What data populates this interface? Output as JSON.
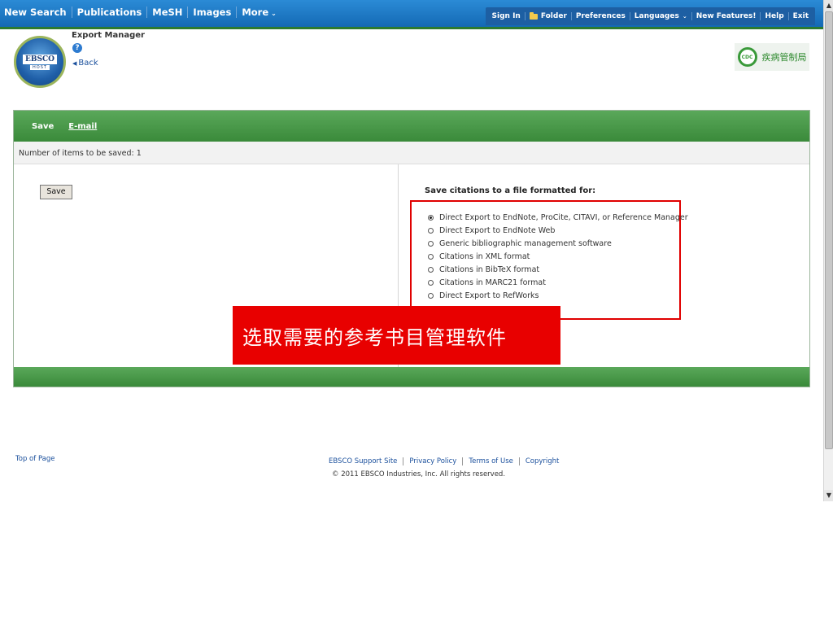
{
  "topnav": {
    "items": [
      "New Search",
      "Publications",
      "MeSH",
      "Images"
    ],
    "more_label": "More",
    "links": [
      "Sign In",
      "Folder",
      "Preferences",
      "Languages",
      "New Features!",
      "Help",
      "Exit"
    ]
  },
  "header": {
    "logo_text": "EBSCO",
    "logo_sub": "HOST",
    "title": "Export Manager",
    "help_icon": "?",
    "back_label": "Back",
    "institution_name": "疾病管制局",
    "institution_emblem": "CDC"
  },
  "panel": {
    "tabs": [
      "Save",
      "E-mail"
    ],
    "items_count_text": "Number of items to be saved: 1",
    "save_button": "Save",
    "format_title": "Save citations to a file formatted for:",
    "formats": [
      {
        "label": "Direct Export to EndNote, ProCite, CITAVI, or Reference Manager",
        "checked": true
      },
      {
        "label": "Direct Export to EndNote Web",
        "checked": false
      },
      {
        "label": "Generic bibliographic management software",
        "checked": false
      },
      {
        "label": "Citations in XML format",
        "checked": false
      },
      {
        "label": "Citations in BibTeX format",
        "checked": false
      },
      {
        "label": "Citations in MARC21 format",
        "checked": false
      },
      {
        "label": "Direct Export to RefWorks",
        "checked": false
      }
    ]
  },
  "callout": {
    "text": "选取需要的参考书目管理软件",
    "color": "#e80000"
  },
  "footer": {
    "top_of_page": "Top of Page",
    "links": [
      "EBSCO Support Site",
      "Privacy Policy",
      "Terms of Use",
      "Copyright"
    ],
    "copyright": "© 2011 EBSCO Industries, Inc. All rights reserved."
  },
  "colors": {
    "nav_blue": "#1469b4",
    "panel_green": "#3a8a3a",
    "link_blue": "#1a4f9c"
  }
}
